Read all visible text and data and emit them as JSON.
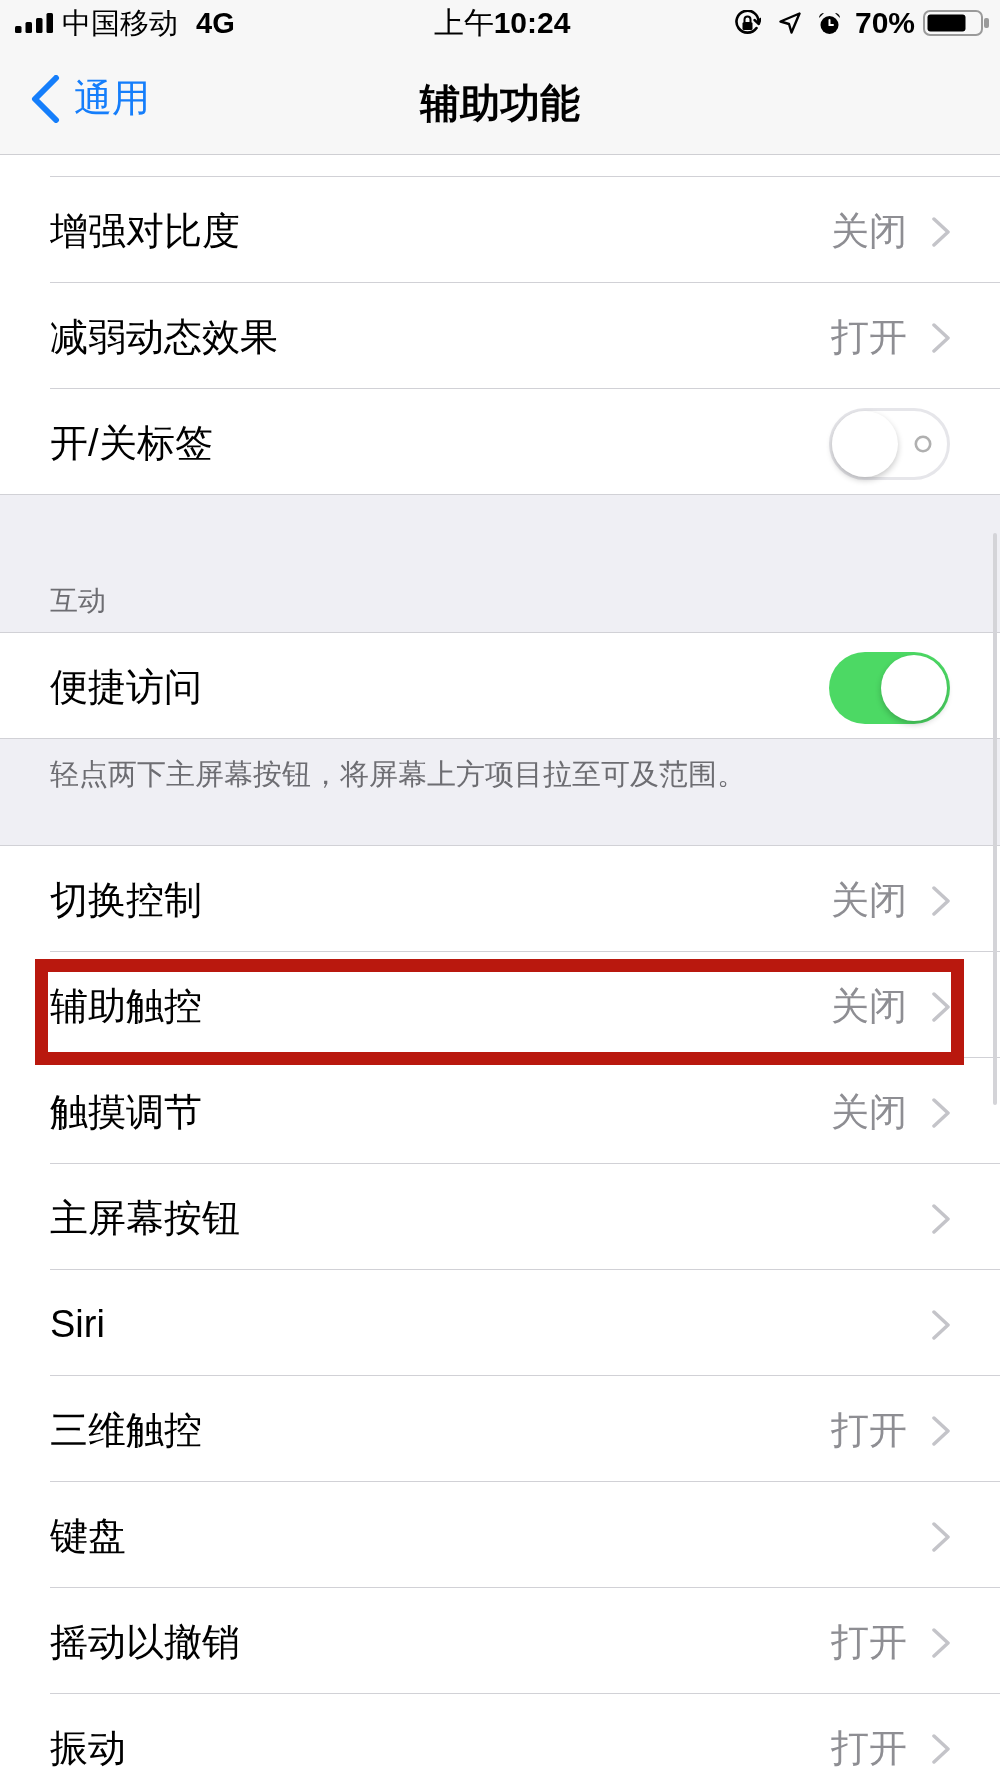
{
  "status_bar": {
    "carrier": "中国移动",
    "network": "4G",
    "time": "上午**10:24**",
    "battery": "70%"
  },
  "nav_bar": {
    "back": "通用",
    "title": "辅助功能"
  },
  "sections": [
    {
      "rows": [
        {
          "label": "增强对比度",
          "kind": "disclosure",
          "value": "关闭",
          "highlighted": false
        },
        {
          "label": "减弱动态效果",
          "kind": "disclosure",
          "value": "打开",
          "highlighted": false
        },
        {
          "label": "开/关标签",
          "kind": "toggle",
          "on": false,
          "highlighted": false
        }
      ]
    },
    {
      "header": "互动",
      "rows": [
        {
          "label": "便捷访问",
          "kind": "toggle",
          "on": true,
          "highlighted": false
        }
      ],
      "footer": "轻点两下主屏幕按钮，将屏幕上方项目拉至可及范围。"
    },
    {
      "rows": [
        {
          "label": "切换控制",
          "kind": "disclosure",
          "value": "关闭",
          "highlighted": false
        },
        {
          "label": "辅助触控",
          "kind": "disclosure",
          "value": "关闭",
          "highlighted": true
        },
        {
          "label": "触摸调节",
          "kind": "disclosure",
          "value": "关闭",
          "highlighted": false
        },
        {
          "label": "主屏幕按钮",
          "kind": "disclosure",
          "highlighted": false
        },
        {
          "label": "Siri",
          "kind": "disclosure",
          "highlighted": false
        },
        {
          "label": "三维触控",
          "kind": "disclosure",
          "value": "打开",
          "highlighted": false
        },
        {
          "label": "键盘",
          "kind": "disclosure",
          "highlighted": false
        },
        {
          "label": "摇动以撤销",
          "kind": "disclosure",
          "value": "打开",
          "highlighted": false
        },
        {
          "label": "振动",
          "kind": "disclosure",
          "value": "打开",
          "highlighted": false
        }
      ]
    }
  ]
}
